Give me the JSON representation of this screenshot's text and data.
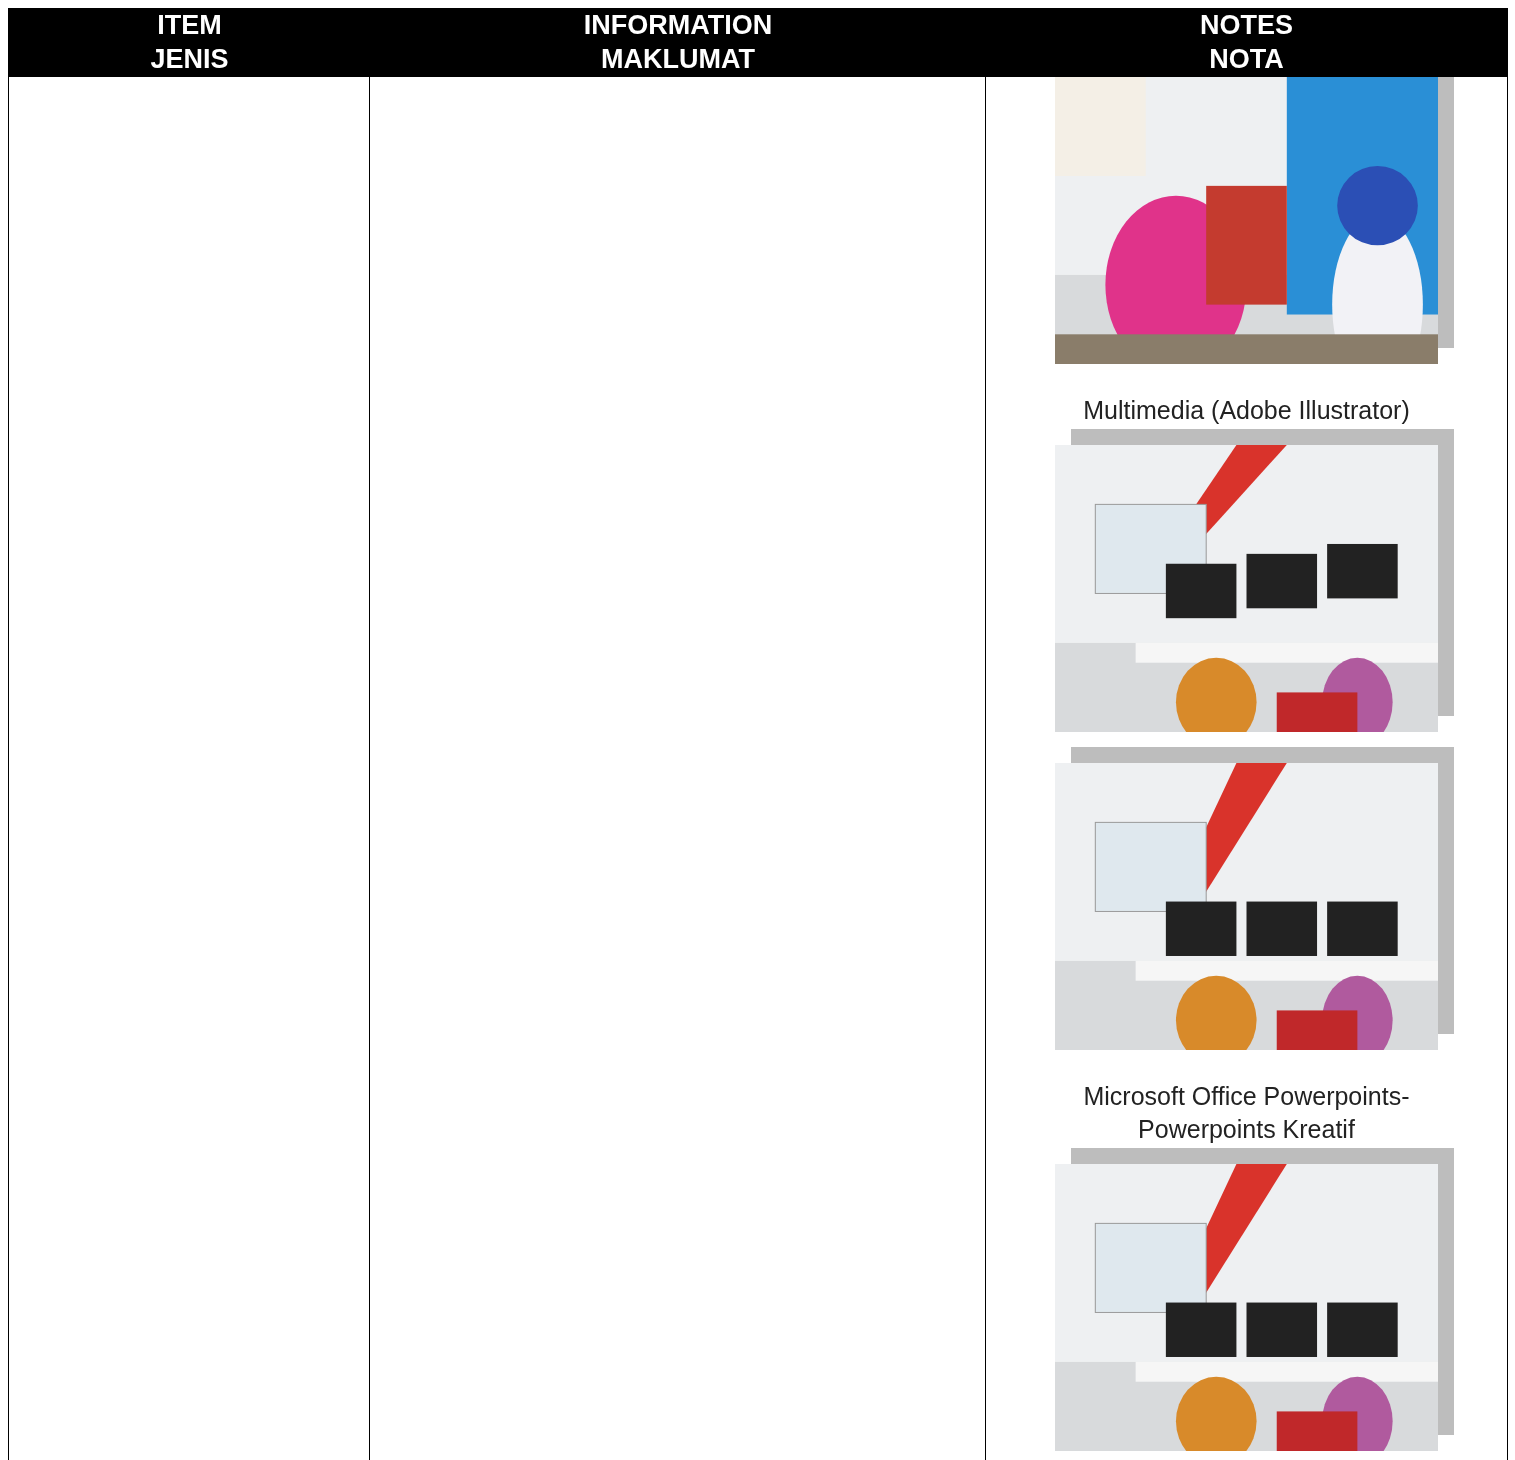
{
  "table": {
    "columns": [
      {
        "label": "ITEM",
        "label_2": "JENIS"
      },
      {
        "label": "INFORMATION",
        "label_2": "MAKLUMAT"
      },
      {
        "label": "NOTES",
        "label_2": "NOTA"
      }
    ],
    "notes": [
      {
        "kind": "picture"
      },
      {
        "kind": "caption",
        "text": "Multimedia (Adobe Illustrator)"
      },
      {
        "kind": "picture"
      },
      {
        "kind": "picture"
      },
      {
        "kind": "caption",
        "text": "Microsoft Office Powerpoints-\nPowerpoints Kreatif"
      },
      {
        "kind": "picture"
      }
    ]
  }
}
